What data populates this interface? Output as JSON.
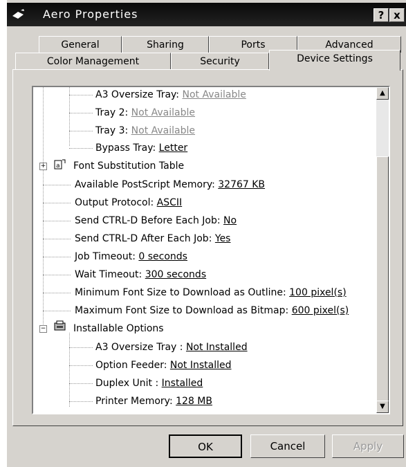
{
  "window": {
    "title": "Aero Properties",
    "help_label": "?",
    "close_label": "x"
  },
  "tabs_row1": [
    "General",
    "Sharing",
    "Ports",
    "Advanced"
  ],
  "tabs_row2": [
    "Color Management",
    "Security",
    "Device Settings"
  ],
  "tree": [
    {
      "label": "A3 Oversize Tray:",
      "value": "Not Available",
      "dim": true
    },
    {
      "label": "Tray 2:",
      "value": "Not Available",
      "dim": true
    },
    {
      "label": "Tray 3:",
      "value": "Not Available",
      "dim": true
    },
    {
      "label": "Bypass Tray:",
      "value": "Letter"
    },
    {
      "label": "Font Substitution Table",
      "value": ""
    },
    {
      "label": "Available PostScript Memory:",
      "value": "32767 KB"
    },
    {
      "label": "Output Protocol:",
      "value": "ASCII"
    },
    {
      "label": "Send CTRL-D Before Each Job:",
      "value": "No"
    },
    {
      "label": "Send CTRL-D After Each Job:",
      "value": "Yes"
    },
    {
      "label": "Job Timeout:",
      "value": "0 seconds"
    },
    {
      "label": "Wait Timeout:",
      "value": "300 seconds"
    },
    {
      "label": "Minimum Font Size to Download as Outline:",
      "value": "100 pixel(s)"
    },
    {
      "label": "Maximum Font Size to Download as Bitmap:",
      "value": "600 pixel(s)"
    },
    {
      "label": "Installable Options",
      "value": ""
    },
    {
      "label": "A3 Oversize Tray :",
      "value": "Not Installed"
    },
    {
      "label": "Option Feeder:",
      "value": "Not Installed"
    },
    {
      "label": "Duplex Unit :",
      "value": "Installed"
    },
    {
      "label": "Printer Memory:",
      "value": "128 MB"
    }
  ],
  "buttons": {
    "ok": "OK",
    "cancel": "Cancel",
    "apply": "Apply"
  },
  "icons": {
    "printer": "printer-icon",
    "font_table": "font-table-icon",
    "options": "options-icon"
  }
}
